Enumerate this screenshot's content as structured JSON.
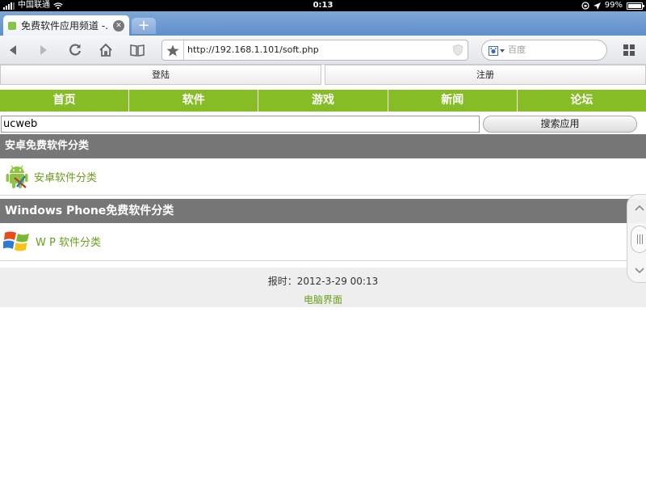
{
  "status": {
    "carrier": "中国联通",
    "time": "0:13",
    "battery": "99%"
  },
  "browser": {
    "tab_title": "免费软件应用频道 -...",
    "new_tab": "+",
    "url": "http://192.168.1.101/soft.php",
    "search_placeholder": "百度"
  },
  "page": {
    "login_label": "登陆",
    "register_label": "注册",
    "nav": [
      "首页",
      "软件",
      "游戏",
      "新闻",
      "论坛"
    ],
    "search_value": "ucweb",
    "search_button": "搜索应用",
    "sections": [
      {
        "header": "安卓免费软件分类",
        "link": "安卓软件分类",
        "icon": "android-icon"
      },
      {
        "header": "Windows Phone免费软件分类",
        "link": "W P 软件分类",
        "icon": "windows-icon"
      }
    ],
    "footer_time": "报时：2012-3-29 00:13",
    "footer_pc": "电脑界面"
  },
  "colors": {
    "nav_green": "#86bd24",
    "link_green": "#6aa01b",
    "section_gray": "#777777"
  }
}
